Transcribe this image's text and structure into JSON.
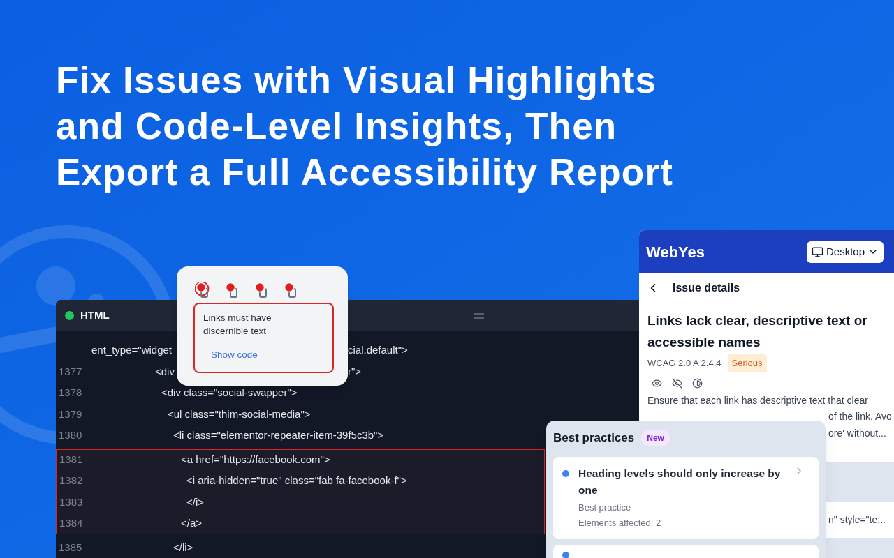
{
  "headline": [
    "Fix Issues with Visual Highlights",
    "and Code-Level Insights, Then",
    "Export a Full Accessibility Report"
  ],
  "code_panel": {
    "title": "HTML",
    "rows": [
      {
        "number": "",
        "text": "ent_type=\"widget",
        "text_right": "cial.default\">",
        "highlighted": false
      },
      {
        "number": "1377",
        "text": "<div",
        "text_right": "r\">",
        "highlighted": false
      },
      {
        "number": "1378",
        "text": "<div class=\"social-swapper\">",
        "highlighted": false
      },
      {
        "number": "1379",
        "text": "<ul class=\"thim-social-media\">",
        "highlighted": false
      },
      {
        "number": "1380",
        "text": "<li class=\"elementor-repeater-item-39f5c3b\">",
        "highlighted": false
      },
      {
        "number": "1381",
        "text": "<a href=\"https://facebook.com\">",
        "highlighted": true
      },
      {
        "number": "1382",
        "text": "<i aria-hidden=\"true\" class=\"fab fa-facebook-f\">",
        "highlighted": true
      },
      {
        "number": "1383",
        "text": "</i>",
        "highlighted": true
      },
      {
        "number": "1384",
        "text": "</a>",
        "highlighted": true
      },
      {
        "number": "1385",
        "text": "</li>",
        "highlighted": false
      }
    ]
  },
  "popup": {
    "markers": [
      {
        "selected": true
      },
      {
        "selected": false
      },
      {
        "selected": false
      },
      {
        "selected": false
      }
    ],
    "message": "Links must have discernible text",
    "link": "Show code"
  },
  "issue_panel": {
    "brand": "WebYes",
    "device": "Desktop",
    "back_title": "Issue details",
    "title": "Links lack clear, descriptive text or accessible names",
    "criterion": "WCAG 2.0 A 2.4.4",
    "severity": "Serious",
    "description_lines": [
      "Ensure that each link has descriptive text that clear",
      "of the link. Avo",
      "ore' without..."
    ],
    "code_snippet": "n\" style=\"te..."
  },
  "best_practices": {
    "title": "Best practices",
    "badge": "New",
    "items": [
      {
        "title": "Heading levels should only increase by one",
        "category": "Best practice",
        "affected": "Elements affected: 2"
      }
    ]
  }
}
